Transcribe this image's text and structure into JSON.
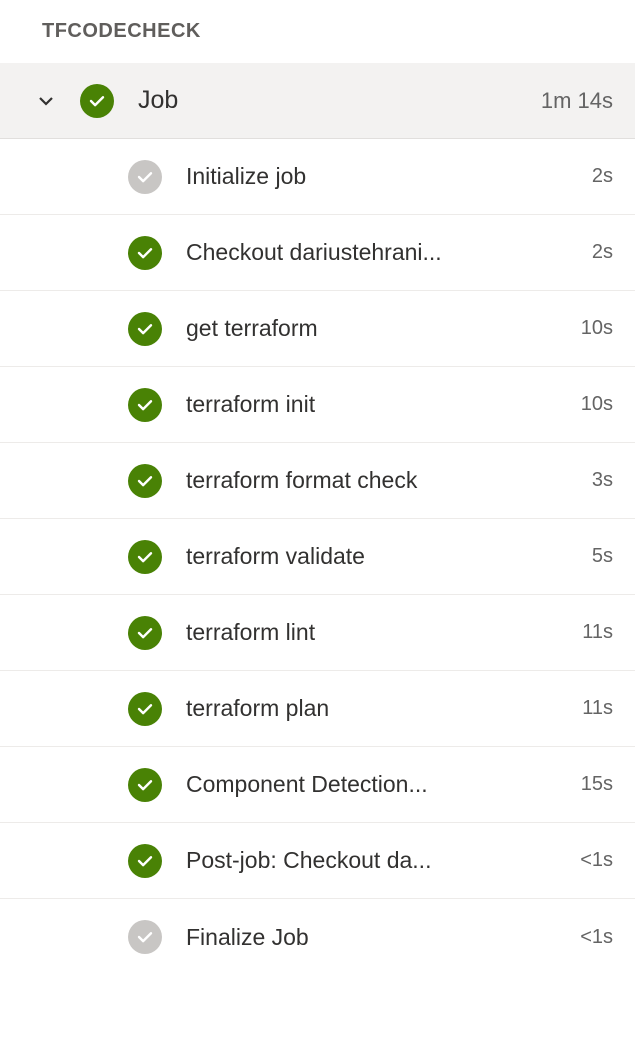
{
  "section_title": "TFCODECHECK",
  "job": {
    "label": "Job",
    "duration": "1m 14s",
    "status": "success"
  },
  "steps": [
    {
      "label": "Initialize job",
      "duration": "2s",
      "status": "neutral"
    },
    {
      "label": "Checkout dariustehrani...",
      "duration": "2s",
      "status": "success"
    },
    {
      "label": "get terraform",
      "duration": "10s",
      "status": "success"
    },
    {
      "label": "terraform init",
      "duration": "10s",
      "status": "success"
    },
    {
      "label": "terraform format check",
      "duration": "3s",
      "status": "success"
    },
    {
      "label": "terraform validate",
      "duration": "5s",
      "status": "success"
    },
    {
      "label": "terraform lint",
      "duration": "11s",
      "status": "success"
    },
    {
      "label": "terraform plan",
      "duration": "11s",
      "status": "success"
    },
    {
      "label": "Component Detection...",
      "duration": "15s",
      "status": "success"
    },
    {
      "label": "Post-job: Checkout da...",
      "duration": "<1s",
      "status": "success"
    },
    {
      "label": "Finalize Job",
      "duration": "<1s",
      "status": "neutral"
    }
  ]
}
